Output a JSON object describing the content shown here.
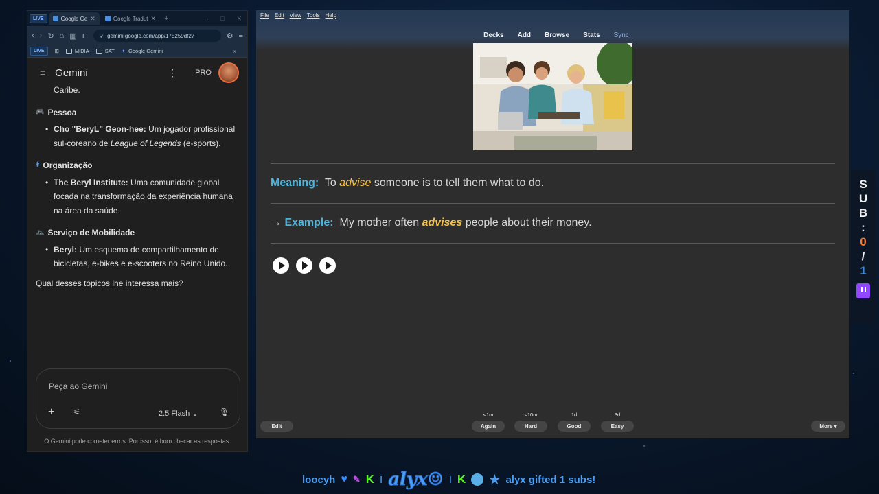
{
  "browser": {
    "live_badge": "LIVE",
    "tabs": [
      {
        "label": "Google Ge",
        "close": "✕"
      },
      {
        "label": "Google Tradut",
        "close": "✕"
      }
    ],
    "new_tab": "+",
    "window_controls": {
      "minimize": "–",
      "maximize": "□",
      "close": "✕"
    },
    "url": "gemini.google.com/app/175259df27",
    "bookmarks": {
      "live": "LIVE",
      "items": [
        {
          "label": "MIDIA"
        },
        {
          "label": "SAT"
        },
        {
          "label": "Google Gemini"
        }
      ],
      "more": "»"
    }
  },
  "gemini": {
    "title": "Gemini",
    "plan": "PRO",
    "chat": {
      "continuation": "Caribe.",
      "sections": [
        {
          "title": "Pessoa",
          "icon": "🎮",
          "items": [
            {
              "bold": "Cho \"BeryL\" Geon-hee:",
              "text": " Um jogador profissional sul-coreano de ",
              "italic": "League of Legends",
              "tail": " (e-sports)."
            }
          ]
        },
        {
          "title": "Organização",
          "icon": "⚕",
          "items": [
            {
              "bold": "The Beryl Institute:",
              "text": " Uma comunidade global focada na transformação da experiência humana na área da saúde.",
              "italic": "",
              "tail": ""
            }
          ]
        },
        {
          "title": "Serviço de Mobilidade",
          "icon": "🚲",
          "items": [
            {
              "bold": "Beryl:",
              "text": " Um esquema de compartilhamento de bicicletas, e-bikes e e-scooters no Reino Unido.",
              "italic": "",
              "tail": ""
            }
          ]
        }
      ],
      "question": "Qual desses tópicos lhe interessa mais?"
    },
    "input": {
      "placeholder": "Peça ao Gemini",
      "model": "2.5 Flash"
    },
    "disclaimer": "O Gemini pode cometer erros. Por isso, é bom checar as respostas."
  },
  "anki": {
    "menu": [
      "File",
      "Edit",
      "View",
      "Tools",
      "Help"
    ],
    "nav": [
      "Decks",
      "Add",
      "Browse",
      "Stats",
      "Sync"
    ],
    "card": {
      "meaning_label": "Meaning:",
      "meaning_pre": "To ",
      "meaning_word": "advise",
      "meaning_post": " someone is to tell them what to do.",
      "arrow": "→",
      "example_label": "Example:",
      "example_pre": "My mother often ",
      "example_word": "advises",
      "example_post": " people about their money."
    },
    "bottom": {
      "edit": "Edit",
      "more": "More ▾",
      "buttons": [
        {
          "label": "Again",
          "time": "<1m"
        },
        {
          "label": "Hard",
          "time": "<10m"
        },
        {
          "label": "Good",
          "time": "1d"
        },
        {
          "label": "Easy",
          "time": "3d"
        }
      ]
    }
  },
  "overlay": {
    "sub_letters": [
      "S",
      "U",
      "B",
      ":"
    ],
    "sub_current": "0",
    "sub_slash": "/",
    "sub_goal": "1",
    "ticker_user": "loocyh",
    "ticker_sep": "I",
    "logo": "alyx☺",
    "ticker_message": "alyx gifted 1 subs!"
  },
  "colors": {
    "accent_blue": "#4fb3d9",
    "highlight": "#f5c04a",
    "twitch": "#9146ff",
    "kick": "#53fc18"
  }
}
